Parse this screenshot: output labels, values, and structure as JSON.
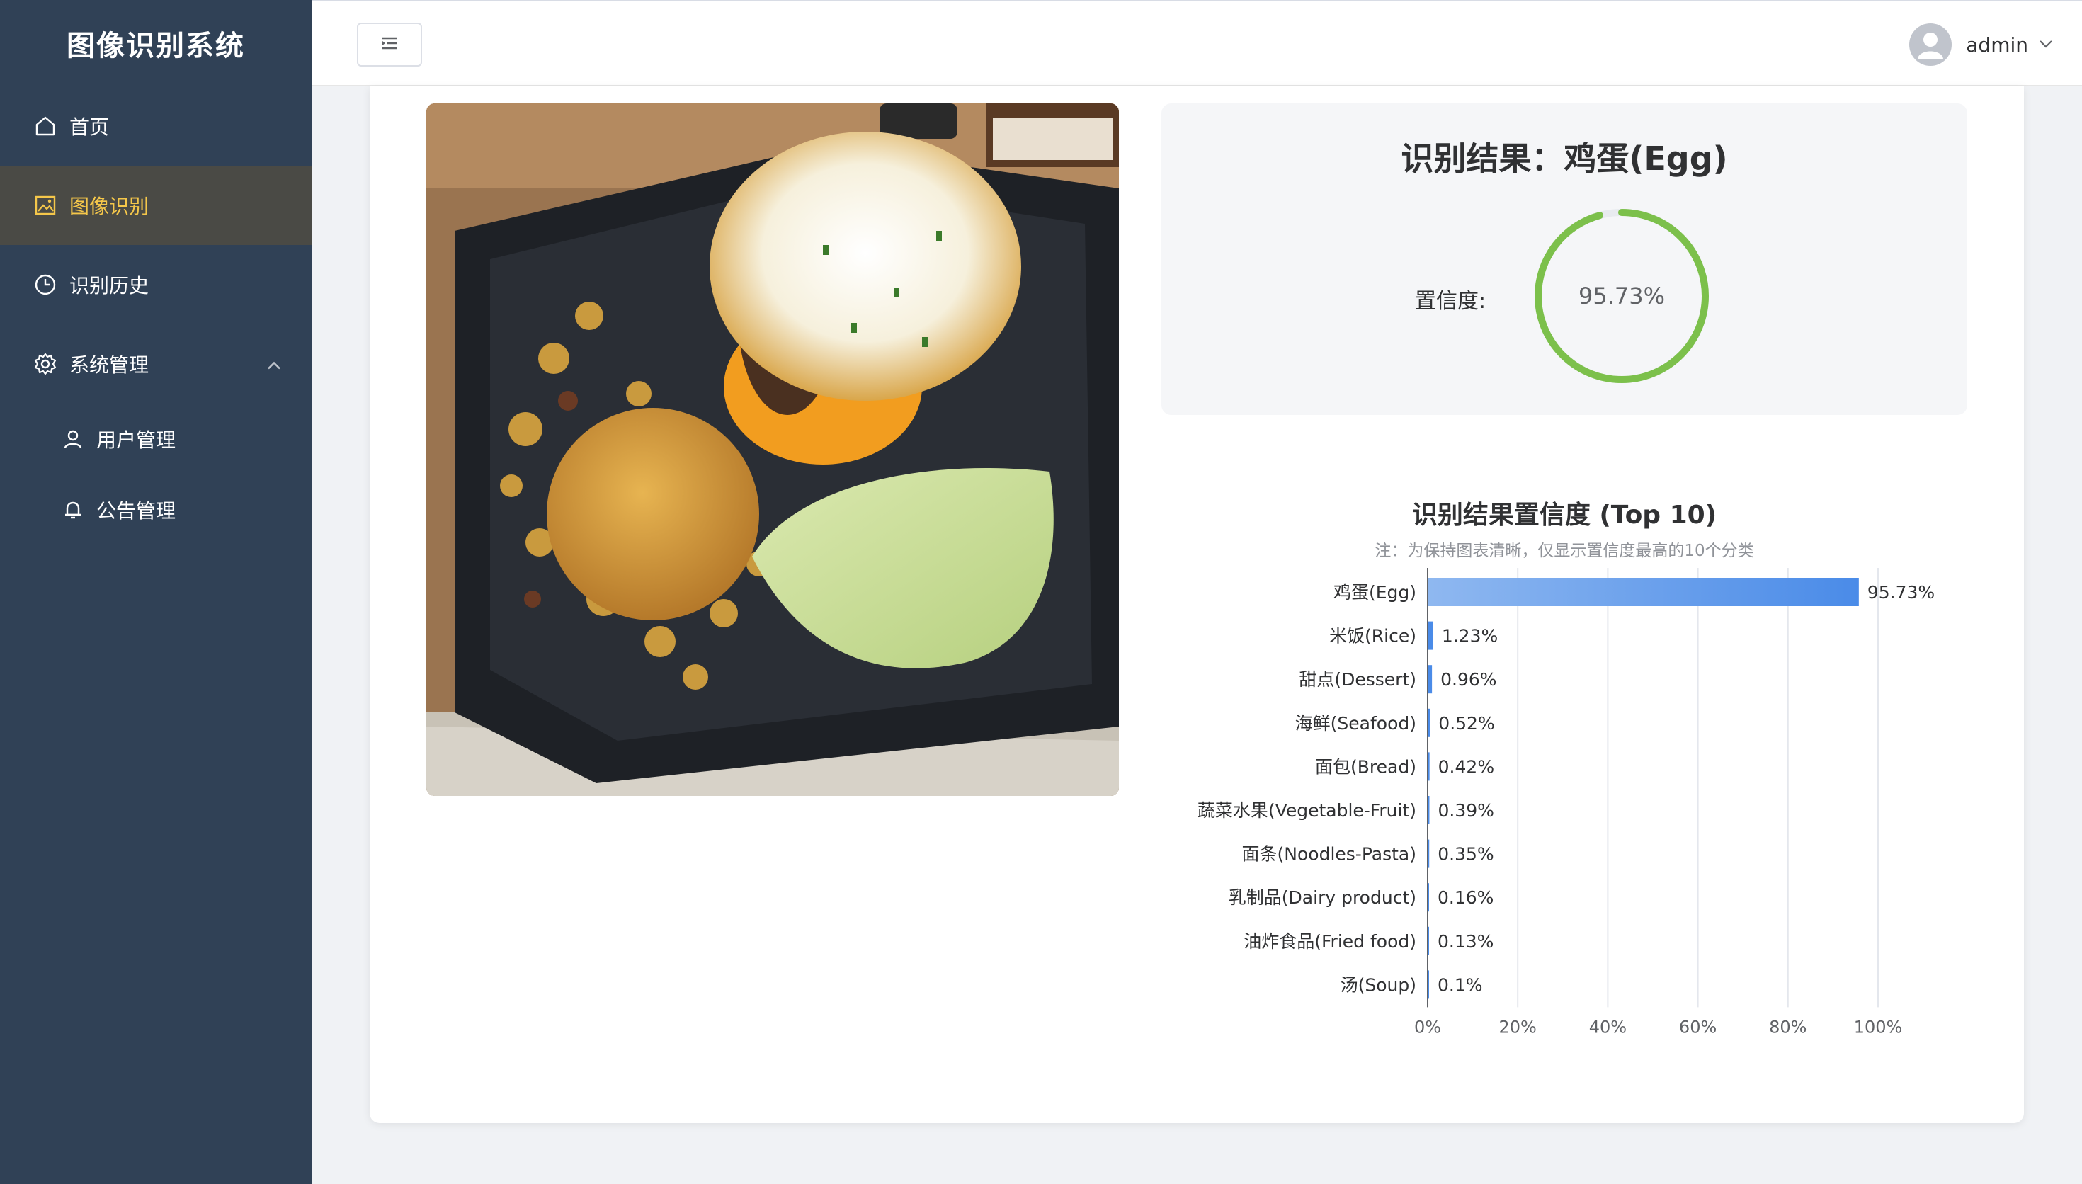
{
  "sidebar": {
    "title": "图像识别系统",
    "items": [
      {
        "label": "首页",
        "icon": "home-icon"
      },
      {
        "label": "图像识别",
        "icon": "image-icon",
        "active": true
      },
      {
        "label": "识别历史",
        "icon": "clock-icon"
      },
      {
        "label": "系统管理",
        "icon": "gear-icon",
        "expanded": true
      }
    ],
    "subitems": [
      {
        "label": "用户管理",
        "icon": "user-icon"
      },
      {
        "label": "公告管理",
        "icon": "bell-icon"
      }
    ]
  },
  "header": {
    "toggle_icon": "menu-fold-icon",
    "username": "admin"
  },
  "result": {
    "title": "识别结果：鸡蛋(Egg)",
    "confidence_label": "置信度:",
    "confidence_text": "95.73%",
    "confidence_value": 95.73
  },
  "colors": {
    "sidebar_bg": "#304156",
    "active_text": "#f5c74a",
    "gauge_green": "#7cc04b",
    "bar_blue": "#4a8be8"
  },
  "chart_data": {
    "type": "bar",
    "orientation": "horizontal",
    "title": "识别结果置信度 (Top 10)",
    "note": "注：为保持图表清晰，仅显示置信度最高的10个分类",
    "categories": [
      "鸡蛋(Egg)",
      "米饭(Rice)",
      "甜点(Dessert)",
      "海鲜(Seafood)",
      "面包(Bread)",
      "蔬菜水果(Vegetable-Fruit)",
      "面条(Noodles-Pasta)",
      "乳制品(Dairy product)",
      "油炸食品(Fried food)",
      "汤(Soup)"
    ],
    "values": [
      95.73,
      1.23,
      0.96,
      0.52,
      0.42,
      0.39,
      0.35,
      0.16,
      0.13,
      0.1
    ],
    "value_labels": [
      "95.73%",
      "1.23%",
      "0.96%",
      "0.52%",
      "0.42%",
      "0.39%",
      "0.35%",
      "0.16%",
      "0.13%",
      "0.1%"
    ],
    "xlim": [
      0,
      100
    ],
    "xticks": [
      "0%",
      "20%",
      "40%",
      "60%",
      "80%",
      "100%"
    ],
    "grid": true
  }
}
